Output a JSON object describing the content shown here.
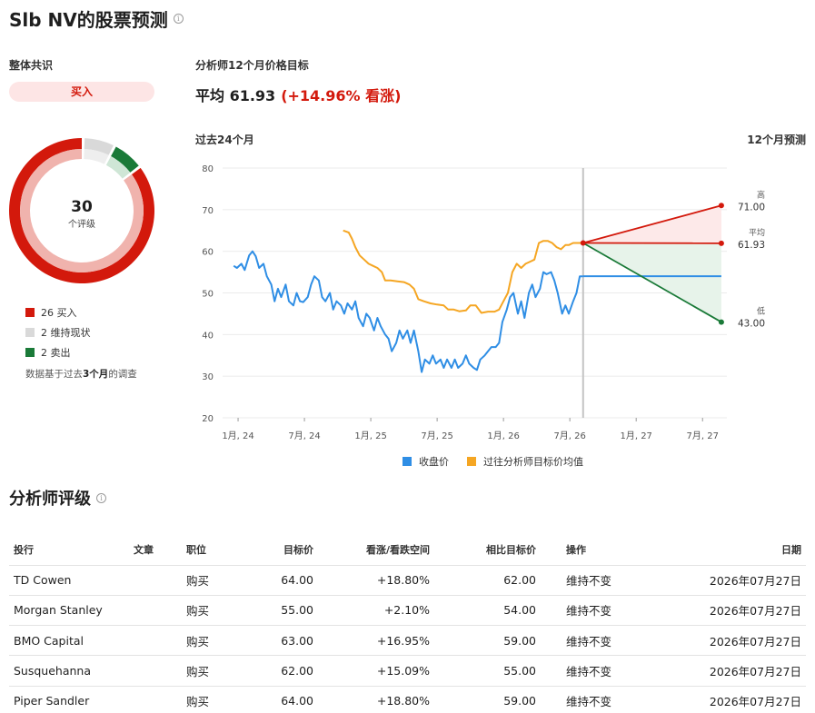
{
  "header": {
    "title": "Slb NV的股票预测",
    "info_glyph": "i"
  },
  "consensus": {
    "label": "整体共识",
    "rating": "买入",
    "total": "30",
    "total_label": "个评级",
    "legend": [
      {
        "label": "26 买入",
        "count": 26,
        "color": "#d3190c"
      },
      {
        "label": "2 维持现状",
        "count": 2,
        "color": "#d9d9d9"
      },
      {
        "label": "2 卖出",
        "count": 2,
        "color": "#1a7a38"
      }
    ],
    "note_prefix": "数据基于过去",
    "note_bold": "3个月",
    "note_suffix": "的调查"
  },
  "target": {
    "label": "分析师12个月价格目标",
    "avg_text": "平均 61.93",
    "change_text": "(+14.96% 看涨)"
  },
  "chart_labels": {
    "past": "过去24个月",
    "forecast": "12个月预测"
  },
  "chart_data": {
    "type": "line",
    "y_ticks": [
      80,
      70,
      60,
      50,
      40,
      30,
      20
    ],
    "ylim": [
      20,
      80
    ],
    "x_ticks": [
      "1月, 24",
      "7月, 24",
      "1月, 25",
      "7月, 25",
      "1月, 26",
      "7月, 26",
      "1月, 27",
      "7月, 27"
    ],
    "x_tick_months": [
      1,
      7,
      13,
      19,
      25,
      31,
      37,
      43
    ],
    "series": [
      {
        "name": "收盘价",
        "color": "#2f8ee5",
        "points": [
          [
            -0.4,
            56.5
          ],
          [
            -0.1,
            56
          ],
          [
            0.3,
            57
          ],
          [
            0.6,
            55.5
          ],
          [
            1.0,
            59
          ],
          [
            1.3,
            60
          ],
          [
            1.6,
            58.8
          ],
          [
            1.9,
            56
          ],
          [
            2.3,
            57
          ],
          [
            2.6,
            54
          ],
          [
            3.0,
            52
          ],
          [
            3.3,
            48
          ],
          [
            3.6,
            51
          ],
          [
            3.9,
            49
          ],
          [
            4.3,
            52
          ],
          [
            4.6,
            48
          ],
          [
            5.0,
            47
          ],
          [
            5.3,
            50
          ],
          [
            5.6,
            48
          ],
          [
            5.9,
            47.8
          ],
          [
            6.3,
            49
          ],
          [
            6.6,
            52
          ],
          [
            6.9,
            54
          ],
          [
            7.3,
            53
          ],
          [
            7.6,
            49
          ],
          [
            7.9,
            48
          ],
          [
            8.3,
            50
          ],
          [
            8.6,
            46
          ],
          [
            8.9,
            48
          ],
          [
            9.3,
            47
          ],
          [
            9.6,
            45
          ],
          [
            9.9,
            47.5
          ],
          [
            10.3,
            46
          ],
          [
            10.6,
            48
          ],
          [
            10.9,
            44
          ],
          [
            11.3,
            42
          ],
          [
            11.6,
            45
          ],
          [
            11.9,
            44
          ],
          [
            12.3,
            41
          ],
          [
            12.6,
            44
          ],
          [
            12.9,
            42
          ],
          [
            13.3,
            40
          ],
          [
            13.6,
            39
          ],
          [
            13.9,
            36
          ],
          [
            14.3,
            38
          ],
          [
            14.6,
            41
          ],
          [
            14.9,
            39
          ],
          [
            15.3,
            41
          ],
          [
            15.6,
            38
          ],
          [
            15.9,
            41
          ],
          [
            16.3,
            36
          ],
          [
            16.6,
            31
          ],
          [
            16.9,
            34
          ],
          [
            17.3,
            33
          ],
          [
            17.6,
            35
          ],
          [
            17.9,
            33
          ],
          [
            18.3,
            34
          ],
          [
            18.6,
            32
          ],
          [
            18.9,
            34
          ],
          [
            19.3,
            32
          ],
          [
            19.6,
            34
          ],
          [
            19.9,
            32
          ],
          [
            20.3,
            33
          ],
          [
            20.6,
            35
          ],
          [
            20.9,
            33
          ],
          [
            21.3,
            32
          ],
          [
            21.6,
            31.5
          ],
          [
            21.9,
            34
          ],
          [
            22.3,
            35
          ],
          [
            22.6,
            36
          ],
          [
            22.9,
            37
          ],
          [
            23.3,
            37
          ],
          [
            23.6,
            38
          ],
          [
            23.9,
            43
          ],
          [
            24.3,
            46
          ],
          [
            24.6,
            49
          ],
          [
            24.9,
            50
          ],
          [
            25.3,
            45
          ],
          [
            25.6,
            48
          ],
          [
            25.9,
            44
          ],
          [
            26.3,
            50
          ],
          [
            26.6,
            52
          ],
          [
            26.9,
            49
          ],
          [
            27.3,
            51
          ],
          [
            27.6,
            55
          ],
          [
            27.9,
            54.5
          ],
          [
            28.3,
            55
          ],
          [
            28.6,
            53
          ],
          [
            28.9,
            50
          ],
          [
            29.3,
            45
          ],
          [
            29.6,
            47
          ],
          [
            29.9,
            45
          ],
          [
            30.3,
            48
          ],
          [
            30.6,
            50
          ],
          [
            30.9,
            54
          ],
          [
            31.2,
            54
          ]
        ]
      },
      {
        "name": "过往分析师目标价均值",
        "color": "#f5a623",
        "points": [
          [
            9.5,
            65
          ],
          [
            10.0,
            64.5
          ],
          [
            10.3,
            63
          ],
          [
            10.6,
            61
          ],
          [
            11.0,
            59
          ],
          [
            11.4,
            58
          ],
          [
            11.8,
            57
          ],
          [
            12.2,
            56.5
          ],
          [
            12.6,
            56
          ],
          [
            13.0,
            55
          ],
          [
            13.3,
            53
          ],
          [
            13.8,
            53
          ],
          [
            14.4,
            52.8
          ],
          [
            15.0,
            52.6
          ],
          [
            15.5,
            52
          ],
          [
            15.9,
            51
          ],
          [
            16.3,
            48.5
          ],
          [
            16.8,
            48
          ],
          [
            17.4,
            47.5
          ],
          [
            18.0,
            47.2
          ],
          [
            18.6,
            47
          ],
          [
            19.0,
            46
          ],
          [
            19.5,
            46
          ],
          [
            20.0,
            45.6
          ],
          [
            20.6,
            45.8
          ],
          [
            21.0,
            47
          ],
          [
            21.5,
            47
          ],
          [
            22.0,
            45.2
          ],
          [
            22.6,
            45.5
          ],
          [
            23.2,
            45.5
          ],
          [
            23.6,
            46
          ],
          [
            24.0,
            48
          ],
          [
            24.4,
            50
          ],
          [
            24.8,
            55
          ],
          [
            25.2,
            57
          ],
          [
            25.6,
            56
          ],
          [
            26.0,
            57
          ],
          [
            26.4,
            57.5
          ],
          [
            26.8,
            58
          ],
          [
            27.2,
            62
          ],
          [
            27.6,
            62.5
          ],
          [
            28.0,
            62.5
          ],
          [
            28.4,
            62
          ],
          [
            28.8,
            61
          ],
          [
            29.2,
            60.5
          ],
          [
            29.6,
            61.5
          ],
          [
            29.9,
            61.5
          ],
          [
            30.3,
            62
          ],
          [
            30.6,
            62
          ],
          [
            31.0,
            62
          ],
          [
            31.2,
            62
          ]
        ]
      }
    ],
    "last_price": 54,
    "forecast": {
      "high": 71.0,
      "avg": 61.93,
      "low": 43.0
    },
    "forecast_labels": {
      "high": "高",
      "avg": "平均",
      "low": "低",
      "high_val": "71.00",
      "avg_val": "61.93",
      "low_val": "43.00"
    }
  },
  "ratings": {
    "title": "分析师评级",
    "columns": [
      "投行",
      "文章",
      "职位",
      "目标价",
      "看涨/看跌空间",
      "相比目标价",
      "操作",
      "日期"
    ],
    "rows": [
      {
        "bank": "TD Cowen",
        "article": "",
        "position": "购买",
        "target": "64.00",
        "upside": "+18.80%",
        "prev": "62.00",
        "action": "维持不变",
        "date": "2026年07月27日"
      },
      {
        "bank": "Morgan Stanley",
        "article": "",
        "position": "购买",
        "target": "55.00",
        "upside": "+2.10%",
        "prev": "54.00",
        "action": "维持不变",
        "date": "2026年07月27日"
      },
      {
        "bank": "BMO Capital",
        "article": "",
        "position": "购买",
        "target": "63.00",
        "upside": "+16.95%",
        "prev": "59.00",
        "action": "维持不变",
        "date": "2026年07月27日"
      },
      {
        "bank": "Susquehanna",
        "article": "",
        "position": "购买",
        "target": "62.00",
        "upside": "+15.09%",
        "prev": "55.00",
        "action": "维持不变",
        "date": "2026年07月27日"
      },
      {
        "bank": "Piper Sandler",
        "article": "",
        "position": "购买",
        "target": "64.00",
        "upside": "+18.80%",
        "prev": "59.00",
        "action": "维持不变",
        "date": "2026年07月27日"
      }
    ]
  }
}
